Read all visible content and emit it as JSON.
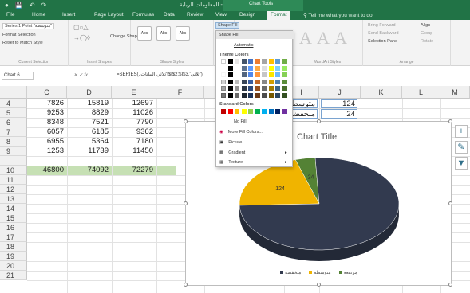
{
  "window": {
    "title": "المعلومات الربابة - Excel",
    "context_tab": "Chart Tools"
  },
  "tabs": [
    {
      "label": "File",
      "active": false
    },
    {
      "label": "Home",
      "active": false
    },
    {
      "label": "Insert",
      "active": false
    },
    {
      "label": "Page Layout",
      "active": false
    },
    {
      "label": "Formulas",
      "active": false
    },
    {
      "label": "Data",
      "active": false
    },
    {
      "label": "Review",
      "active": false
    },
    {
      "label": "View",
      "active": false
    },
    {
      "label": "Design",
      "active": false
    },
    {
      "label": "Format",
      "active": true
    }
  ],
  "tell_me": "Tell me what you want to do",
  "ribbon": {
    "current_selection": {
      "dropdown": "Series 1 Point \"متوسطة\"",
      "format_selection": "Format Selection",
      "reset": "Reset to Match Style",
      "label": "Current Selection"
    },
    "insert_shapes": {
      "change_shape": "Change Shape",
      "label": "Insert Shapes"
    },
    "shape_styles": {
      "label": "Shape Styles",
      "samples": [
        "Abc",
        "Abc",
        "Abc"
      ],
      "fill_button": "Shape Fill"
    },
    "wordart_label": "WordArt Styles",
    "arrange": {
      "bring_forward": "Bring Forward",
      "send_backward": "Send Backward",
      "selection_pane": "Selection Pane",
      "align": "Align",
      "group": "Group",
      "rotate": "Rotate",
      "label": "Arrange"
    }
  },
  "formula_bar": {
    "name_box": "Chart 6",
    "formula": "=SERIES(,'ثلاثي البيانات'!$I$2:$I$3,'ثلاثي')"
  },
  "columns": [
    "C",
    "D",
    "E",
    "F",
    "",
    "I",
    "J",
    "K",
    "L",
    "M"
  ],
  "rows": [
    {
      "n": "4",
      "c": "7826",
      "d": "15819",
      "e": "12697"
    },
    {
      "n": "5",
      "c": "9253",
      "d": "8829",
      "e": "11026"
    },
    {
      "n": "6",
      "c": "8348",
      "d": "7521",
      "e": "7790"
    },
    {
      "n": "7",
      "c": "6057",
      "d": "6185",
      "e": "9362"
    },
    {
      "n": "8",
      "c": "6955",
      "d": "5364",
      "e": "7180"
    },
    {
      "n": "9",
      "c": "1253",
      "d": "11739",
      "e": "11450"
    },
    {
      "n": "10",
      "c": "46800",
      "d": "74092",
      "e": "72279"
    },
    {
      "n": "11"
    },
    {
      "n": "12"
    },
    {
      "n": "13"
    },
    {
      "n": "14"
    },
    {
      "n": "15"
    },
    {
      "n": "16"
    },
    {
      "n": "17"
    },
    {
      "n": "18"
    },
    {
      "n": "19"
    },
    {
      "n": "20"
    },
    {
      "n": "21"
    }
  ],
  "ij_cells": [
    {
      "label": "متوسطة",
      "value": "124"
    },
    {
      "label": "منخفضة",
      "value": "24"
    }
  ],
  "shape_fill_menu": {
    "header": "Shape Fill",
    "automatic": "Automatic",
    "theme_colors": "Theme Colors",
    "standard_colors": "Standard Colors",
    "no_fill": "No Fill",
    "more_colors": "More Fill Colors...",
    "picture": "Picture...",
    "gradient": "Gradient",
    "texture": "Texture",
    "theme_palette": [
      "#ffffff",
      "#000000",
      "#e7e6e6",
      "#44546a",
      "#4472c4",
      "#ed7d31",
      "#a5a5a5",
      "#ffc000",
      "#5b9bd5",
      "#70ad47"
    ],
    "standard_palette": [
      "#c00000",
      "#ff0000",
      "#ffc000",
      "#ffff00",
      "#92d050",
      "#00b050",
      "#00b0f0",
      "#0070c0",
      "#002060",
      "#7030a0"
    ]
  },
  "chart": {
    "title": "Chart Title",
    "legend_position": "bottom",
    "side_buttons": [
      "+",
      "brush",
      "filter"
    ]
  },
  "chart_data": {
    "type": "pie",
    "title": "Chart Title",
    "categories": [
      "منخفضة",
      "متوسطة",
      "مرتفعة"
    ],
    "values": [
      24,
      124,
      450
    ],
    "colors": [
      "#548235",
      "#f0b400",
      "#323a4f"
    ],
    "data_labels": [
      "24",
      "124",
      ""
    ],
    "style": "3d"
  }
}
